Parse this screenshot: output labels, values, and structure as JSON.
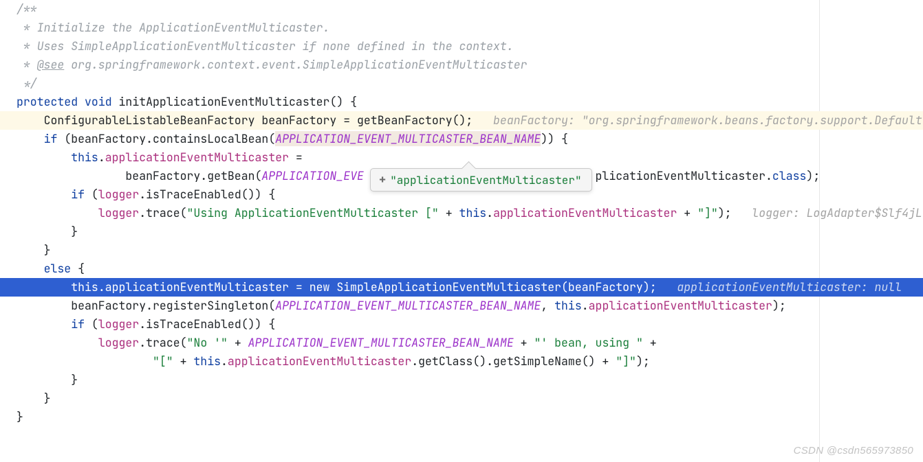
{
  "code": {
    "l1": "/**",
    "l2": " * Initialize the ApplicationEventMulticaster.",
    "l3": " * Uses SimpleApplicationEventMulticaster if none defined in the context.",
    "l4_pre": " * ",
    "l4_at": "@see",
    "l4_post": " org.springframework.context.event.SimpleApplicationEventMulticaster",
    "l5": " */",
    "l6_a": "protected",
    "l6_b": "void",
    "l6_c": "initApplicationEventMulticaster",
    "l7_a": "ConfigurableListableBeanFactory beanFactory = getBeanFactory();",
    "l7_hint": "beanFactory: \"org.springframework.beans.factory.support.Default",
    "l8_a": "if",
    "l8_b": " (beanFactory.containsLocalBean(",
    "l8_c": "APPLICATION_EVENT_MULTICASTER_BEAN_NAME",
    "l8_d": ")) {",
    "l9_a": "this",
    "l9_b": ".",
    "l9_c": "applicationEventMulticaster",
    "l9_d": " =",
    "l10_a": "beanFactory.getBean(",
    "l10_b": "APPLICATION_EVE",
    "l10_c": "plicationEventMulticaster.",
    "l10_d": "class",
    "l10_e": ");",
    "l11_a": "if",
    "l11_b": " (",
    "l11_c": "logger",
    "l11_d": ".isTraceEnabled()) {",
    "l12_a": "logger",
    "l12_b": ".trace(",
    "l12_c": "\"Using ApplicationEventMulticaster [\"",
    "l12_d": " + ",
    "l12_e": "this",
    "l12_f": ".",
    "l12_g": "applicationEventMulticaster",
    "l12_h": " + ",
    "l12_i": "\"]\"",
    "l12_j": ");",
    "l12_hint": "logger: LogAdapter$Slf4jL",
    "l13": "}",
    "l14": "}",
    "l15_a": "else",
    "l15_b": " {",
    "l16_a": "this",
    "l16_b": ".",
    "l16_c": "applicationEventMulticaster",
    "l16_d": " = ",
    "l16_e": "new",
    "l16_f": " SimpleApplicationEventMulticaster(beanFactory);",
    "l16_hint": "applicationEventMulticaster: null  ",
    "l17_a": "beanFactory.registerSingleton(",
    "l17_b": "APPLICATION_EVENT_MULTICASTER_BEAN_NAME",
    "l17_c": ", ",
    "l17_d": "this",
    "l17_e": ".",
    "l17_f": "applicationEventMulticaster",
    "l17_g": ");",
    "l18_a": "if",
    "l18_b": " (",
    "l18_c": "logger",
    "l18_d": ".isTraceEnabled()) {",
    "l19_a": "logger",
    "l19_b": ".trace(",
    "l19_c": "\"No '\"",
    "l19_d": " + ",
    "l19_e": "APPLICATION_EVENT_MULTICASTER_BEAN_NAME",
    "l19_f": " + ",
    "l19_g": "\"' bean, using \"",
    "l19_h": " +",
    "l20_a": "\"[\"",
    "l20_b": " + ",
    "l20_c": "this",
    "l20_d": ".",
    "l20_e": "applicationEventMulticaster",
    "l20_f": ".getClass().getSimpleName() + ",
    "l20_g": "\"]\"",
    "l20_h": ");",
    "l21": "}",
    "l22": "}",
    "l23": "}"
  },
  "tooltip": {
    "value": "\"applicationEventMulticaster\""
  },
  "watermark": "CSDN @csdn565973850",
  "indent": {
    "i1": "    ",
    "i2": "        ",
    "i3": "            ",
    "i4": "                ",
    "i5": "                    "
  }
}
